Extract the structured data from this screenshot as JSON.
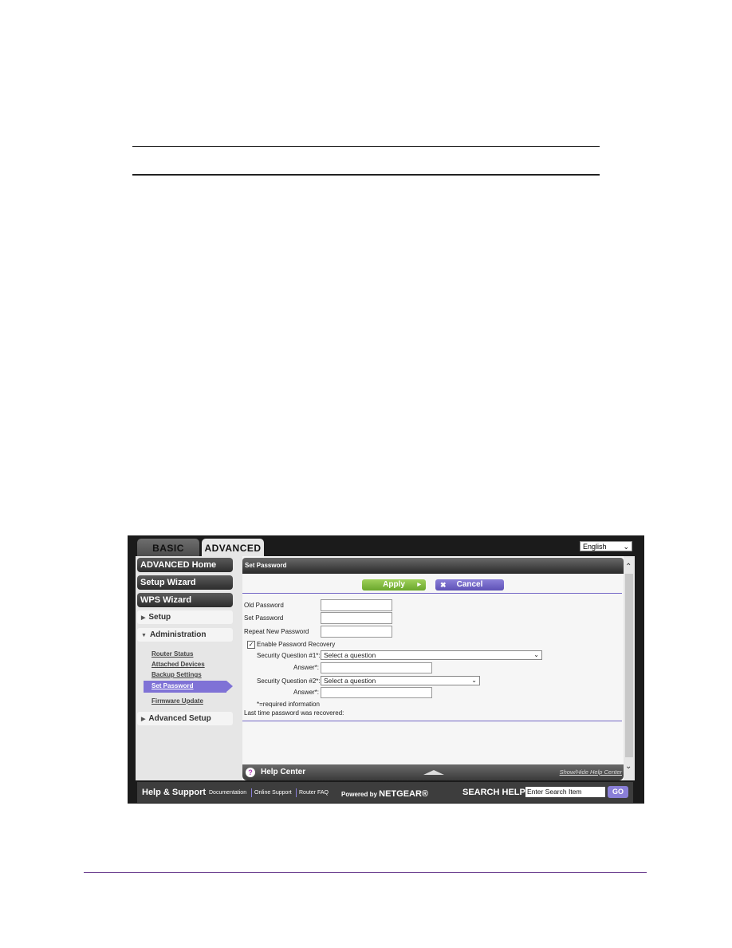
{
  "router_ui": {
    "tabs": [
      {
        "label": "BASIC",
        "active": false
      },
      {
        "label": "ADVANCED",
        "active": true
      }
    ],
    "language": {
      "selected": "English"
    },
    "sidebar": {
      "buttons": [
        "ADVANCED Home",
        "Setup Wizard",
        "WPS Wizard"
      ],
      "sections": [
        {
          "label": "Setup",
          "expanded": false
        },
        {
          "label": "Administration",
          "expanded": true
        },
        {
          "label": "Advanced Setup",
          "expanded": false
        }
      ],
      "admin_links": [
        "Router Status",
        "Attached Devices",
        "Backup Settings",
        "Set Password",
        "Firmware Update"
      ],
      "active_link": "Set Password"
    },
    "main": {
      "title": "Set Password",
      "apply_label": "Apply",
      "cancel_label": "Cancel",
      "fields": {
        "old_password": {
          "label": "Old Password",
          "value": ""
        },
        "set_password": {
          "label": "Set Password",
          "value": ""
        },
        "repeat_password": {
          "label": "Repeat New Password",
          "value": ""
        }
      },
      "recovery": {
        "label": "Enable Password Recovery",
        "checked": true,
        "q1_label": "Security Question #1*:",
        "q1_value": "Select a question",
        "a1_label": "Answer*:",
        "q2_label": "Security Question #2*:",
        "q2_value": "Select a question",
        "a2_label": "Answer*:"
      },
      "required_note": "*=required information",
      "last_recovered": "Last time password was recovered:"
    },
    "help_center": {
      "title": "Help Center",
      "icon": "?",
      "toggle_label": "Show/Hide Help Center"
    },
    "footer": {
      "title": "Help & Support",
      "links": [
        "Documentation",
        "Online Support",
        "Router FAQ"
      ],
      "powered_prefix": "Powered by",
      "brand": "NETGEAR®",
      "search_label": "SEARCH HELP",
      "search_placeholder": "Enter Search Item",
      "go_label": "GO"
    }
  },
  "colors": {
    "accent_purple": "#7f72d6",
    "apply_green": "#7ab83a",
    "page_rule": "#6a3d8f"
  }
}
